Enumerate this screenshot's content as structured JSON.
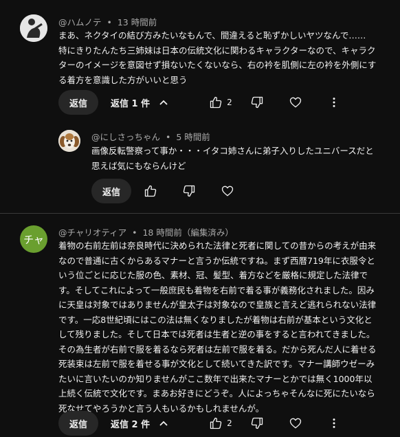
{
  "comments": [
    {
      "author": "@ハムノテ",
      "dot": "•",
      "time": "13 時間前",
      "lines": [
        "まあ、ネクタイの結び方みたいなもんで、間違えると恥ずかしいヤツなんで……",
        "特にきりたんたち三姉妹は日本の伝統文化に関わるキャラクターなので、キャラク",
        "ターのイメージを意図せず損ないたくないなら、右の衿を肌側に左の衿を外側にす",
        "る着方を意識した方がいいと思う"
      ],
      "reply_label": "返信",
      "replies_label": "返信 1 件",
      "like_count": "2",
      "reply": {
        "author": "@にしさっちゃん",
        "dot": "•",
        "time": "5 時間前",
        "lines": [
          "画像反転警察って事か・・・イタコ姉さんに弟子入りしたユニバースだと",
          "思えば気にもならんけど"
        ],
        "reply_label": "返信"
      }
    },
    {
      "author": "@チャリオティア",
      "dot": "•",
      "time": "18 時間前（編集済み）",
      "avatar_text": "チャ",
      "avatar_color": "#6a9f2f",
      "lines": [
        "着物の右前左前は奈良時代に決められた法律と死者に関しての昔からの考えが由来",
        "なので普通に古くからあるマナーと言うか伝統ですね。まず西暦719年に衣服令と",
        "いう位ごとに応じた服の色、素材、冠、髪型、着方などを厳格に規定した法律で",
        "す。そしてこれによって一般庶民も着物を右前で着る事が義務化されました。因み",
        "に天皇は対象ではありませんが皇太子は対象なので皇族と言えど逃れられない法律",
        "です。一応8世紀頃にはこの法は無くなりましたが着物は右前が基本という文化と",
        "して残りました。そして日本では死者は生者と逆の事をすると言われてきました。",
        "その為生者が右前で服を着るなら死者は左前で服を着る。だから死んだ人に着せる",
        "死装束は左前で服を着せる事が文化として続いてきた訳です。マナー講師ウゼーみ",
        "たいに言いたいのか知りませんがここ数年で出来たマナーとかでは無く1000年以",
        "上続く伝統で文化です。まあお好きにどうぞ。人によっちゃそんなに死にたいなら",
        "死なせてやろうかと言う人もいるかもしれませんが。"
      ],
      "reply_label": "返信",
      "replies_label": "返信 2 件",
      "like_count": "2"
    }
  ],
  "icons": {
    "like": "thumb-up-icon",
    "dislike": "thumb-down-icon",
    "heart": "heart-icon",
    "more": "more-vert-icon",
    "chevron": "chevron-up-icon"
  }
}
